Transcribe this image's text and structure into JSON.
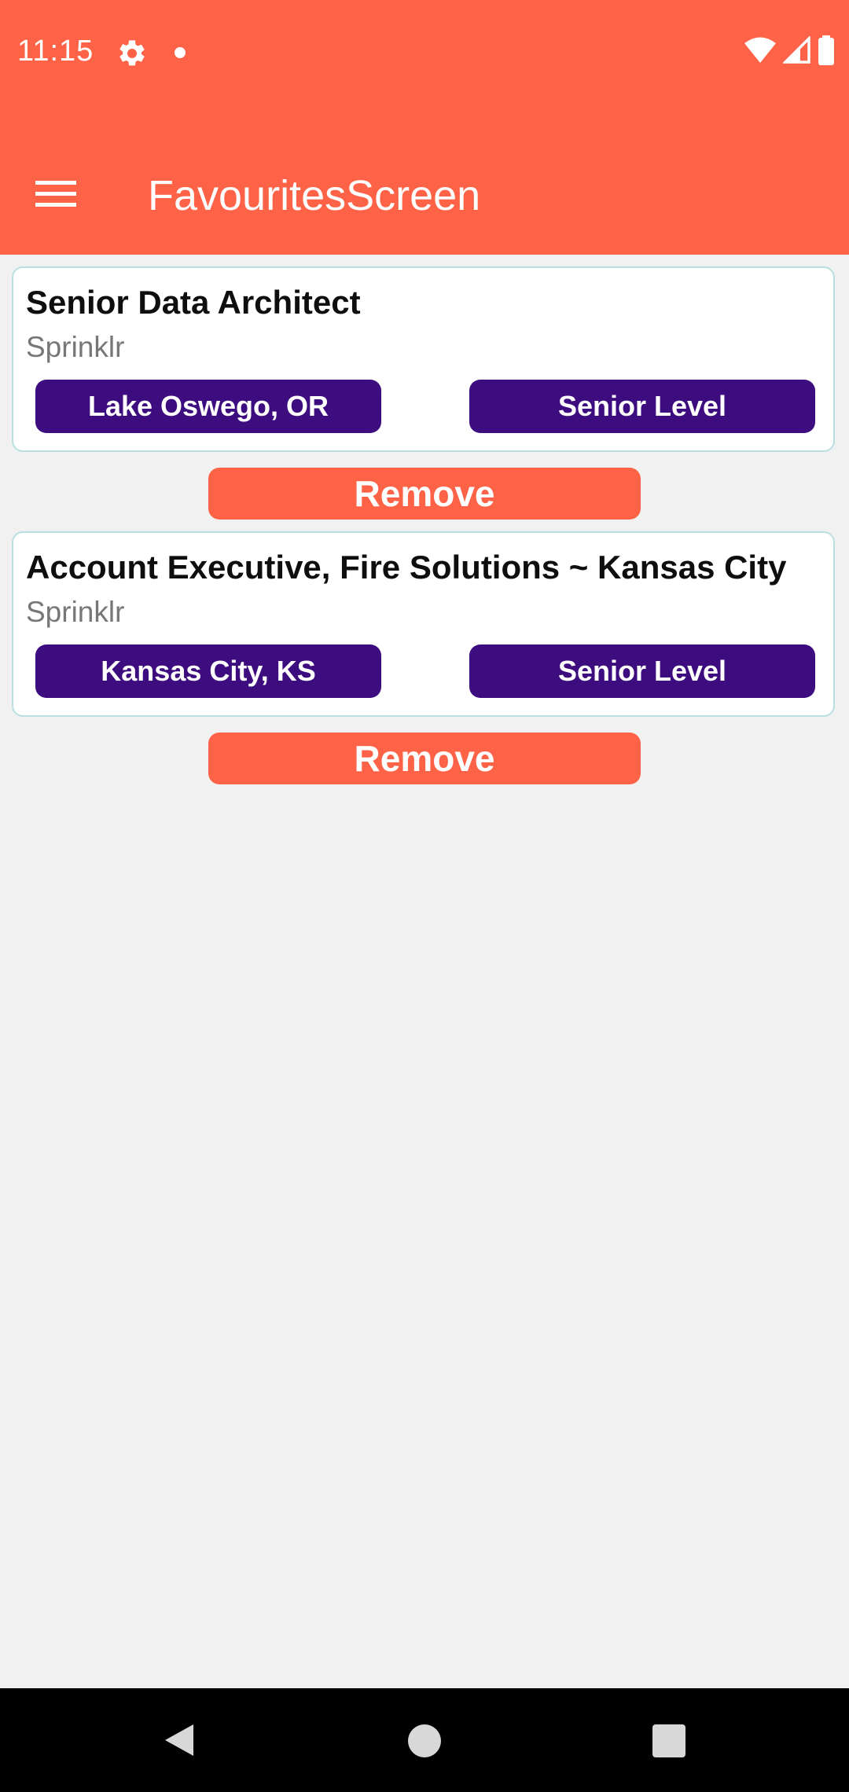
{
  "status_bar": {
    "time": "11:15",
    "icons": [
      "gear-icon",
      "notification-dot-icon",
      "wifi-icon",
      "signal-icon",
      "battery-icon"
    ]
  },
  "app_bar": {
    "title": "FavouritesScreen",
    "menu_icon": "hamburger-menu-icon",
    "background_color": "#ff6347"
  },
  "favourites": [
    {
      "title": "Senior Data Architect",
      "company": "Sprinklr",
      "location": "Lake Oswego, OR",
      "level": "Senior Level",
      "remove_label": "Remove"
    },
    {
      "title": "Account Executive, Fire Solutions ~ Kansas City",
      "company": "Sprinklr",
      "location": "Kansas City, KS",
      "level": "Senior Level",
      "remove_label": "Remove"
    }
  ],
  "colors": {
    "accent": "#ff6347",
    "chip": "#3d0c7f",
    "card_border": "#b9dfe0",
    "background": "#f1f1f1"
  },
  "nav_bar": {
    "icons": [
      "back-icon",
      "home-icon",
      "recents-icon"
    ]
  }
}
